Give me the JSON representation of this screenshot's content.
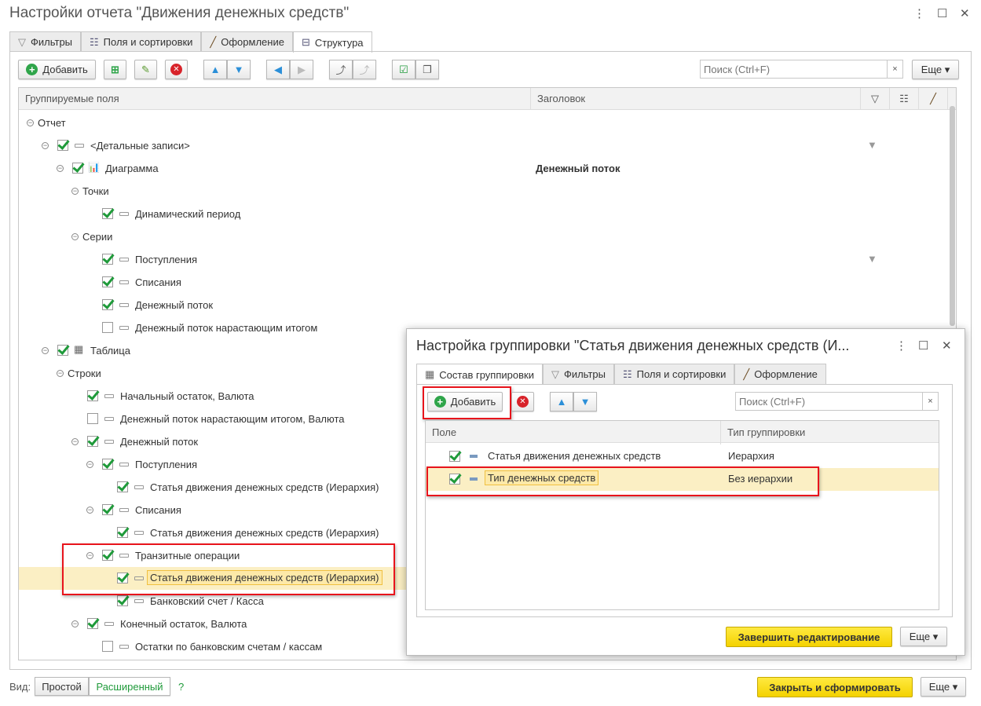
{
  "window": {
    "title": "Настройки отчета \"Движения денежных средств\"",
    "menu": "⋮",
    "maximize": "☐",
    "close": "✕"
  },
  "tabs": [
    {
      "label": "Фильтры",
      "icon": "filter-icon"
    },
    {
      "label": "Поля и сортировки",
      "icon": "sort-fields-icon"
    },
    {
      "label": "Оформление",
      "icon": "brush-icon"
    },
    {
      "label": "Структура",
      "icon": "structure-icon",
      "active": true
    }
  ],
  "toolbar": {
    "add": "Добавить",
    "search_placeholder": "Поиск (Ctrl+F)",
    "clear": "×",
    "more": "Еще ▾"
  },
  "tree": {
    "columns": [
      "Группируемые поля",
      "Заголовок"
    ],
    "rows": [
      {
        "level": 0,
        "toggle": true,
        "cb": null,
        "icon": null,
        "label": "Отчет"
      },
      {
        "level": 1,
        "toggle": true,
        "cb": true,
        "icon": "field",
        "label": "<Детальные записи>",
        "filter": true
      },
      {
        "level": 2,
        "toggle": true,
        "cb": true,
        "icon": "chart",
        "label": "Диаграмма",
        "title": "Денежный поток"
      },
      {
        "level": 3,
        "toggle": true,
        "cb": null,
        "icon": null,
        "label": "Точки"
      },
      {
        "level": 4,
        "toggle": false,
        "cb": true,
        "icon": "field",
        "label": "Динамический период"
      },
      {
        "level": 3,
        "toggle": true,
        "cb": null,
        "icon": null,
        "label": "Серии"
      },
      {
        "level": 4,
        "toggle": false,
        "cb": true,
        "icon": "field",
        "label": "Поступления",
        "filter": true
      },
      {
        "level": 4,
        "toggle": false,
        "cb": true,
        "icon": "field",
        "label": "Списания"
      },
      {
        "level": 4,
        "toggle": false,
        "cb": true,
        "icon": "field",
        "label": "Денежный поток"
      },
      {
        "level": 4,
        "toggle": false,
        "cb": false,
        "icon": "field",
        "label": "Денежный поток нарастающим итогом"
      },
      {
        "level": 1,
        "toggle": true,
        "cb": true,
        "icon": "table",
        "label": "Таблица"
      },
      {
        "level": 2,
        "toggle": true,
        "cb": null,
        "icon": null,
        "label": "Строки"
      },
      {
        "level": 3,
        "toggle": false,
        "cb": true,
        "icon": "field",
        "label": "Начальный остаток, Валюта"
      },
      {
        "level": 3,
        "toggle": false,
        "cb": false,
        "icon": "field",
        "label": "Денежный поток нарастающим итогом, Валюта"
      },
      {
        "level": 3,
        "toggle": true,
        "cb": true,
        "icon": "field",
        "label": "Денежный поток"
      },
      {
        "level": 4,
        "toggle": true,
        "cb": true,
        "icon": "field",
        "label": "Поступления"
      },
      {
        "level": 5,
        "toggle": false,
        "cb": true,
        "icon": "field",
        "label": "Статья движения денежных средств (Иерархия)"
      },
      {
        "level": 4,
        "toggle": true,
        "cb": true,
        "icon": "field",
        "label": "Списания"
      },
      {
        "level": 5,
        "toggle": false,
        "cb": true,
        "icon": "field",
        "label": "Статья движения денежных средств (Иерархия)"
      },
      {
        "level": 4,
        "toggle": true,
        "cb": true,
        "icon": "field",
        "label": "Транзитные операции"
      },
      {
        "level": 5,
        "toggle": false,
        "cb": true,
        "icon": "field",
        "label": "Статья движения денежных средств (Иерархия)",
        "selected": true
      },
      {
        "level": 5,
        "toggle": false,
        "cb": true,
        "icon": "field",
        "label": "Банковский счет / Касса"
      },
      {
        "level": 3,
        "toggle": true,
        "cb": true,
        "icon": "field",
        "label": "Конечный остаток, Валюта"
      },
      {
        "level": 4,
        "toggle": false,
        "cb": false,
        "icon": "field",
        "label": "Остатки по банковским счетам / кассам"
      }
    ]
  },
  "footer": {
    "view_label": "Вид:",
    "simple": "Простой",
    "advanced": "Расширенный",
    "help": "?",
    "generate": "Закрыть и сформировать",
    "more": "Еще ▾"
  },
  "dialog": {
    "title": "Настройка группировки \"Статья движения денежных средств (И...",
    "tabs": [
      {
        "label": "Состав группировки",
        "active": true
      },
      {
        "label": "Фильтры"
      },
      {
        "label": "Поля и сортировки"
      },
      {
        "label": "Оформление"
      }
    ],
    "add": "Добавить",
    "search_placeholder": "Поиск (Ctrl+F)",
    "clear": "×",
    "columns": [
      "Поле",
      "Тип группировки"
    ],
    "rows": [
      {
        "checked": true,
        "field": "Статья движения денежных средств",
        "type": "Иерархия"
      },
      {
        "checked": true,
        "field": "Тип денежных средств",
        "type": "Без иерархии",
        "selected": true
      }
    ],
    "finish": "Завершить редактирование",
    "more": "Еще ▾"
  },
  "colors": {
    "accent_yellow": "#f4d200",
    "selection": "#fbefc4",
    "highlight_red": "#e8141c",
    "check_green": "#1f9a3a"
  }
}
